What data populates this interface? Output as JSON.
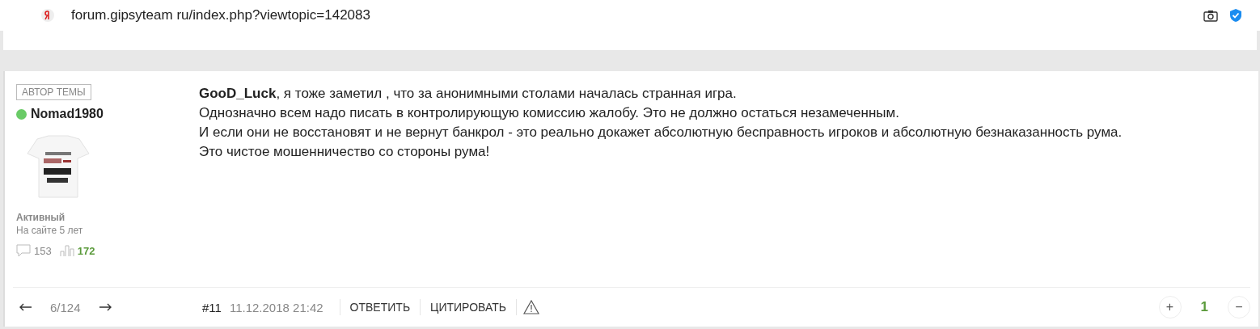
{
  "browser": {
    "url": "forum.gipsyteam ru/index.php?viewtopic=142083"
  },
  "post": {
    "author": {
      "badge": "АВТОР ТЕМЫ",
      "name": "Nomad1980",
      "online": true,
      "rank": "Активный",
      "since": "На сайте 5 лет",
      "posts": "153",
      "rating": "172"
    },
    "body": {
      "mention": "GooD_Luck",
      "lines": [
        ", я тоже заметил , что за анонимными столами началась странная игра.",
        "Однозначно всем надо писать в контролирующую комиссию жалобу. Это не должно остаться незамеченным.",
        "И если они не восстановят и не вернут банкрол - это реально докажет абсолютную бесправность игроков и абсолютную безнаказанность рума.",
        "Это чистое мошенничество со стороны рума!"
      ]
    },
    "footer": {
      "position": "6/124",
      "number": "#11",
      "date": "11.12.2018 21:42",
      "actions": [
        "ОТВЕТИТЬ",
        "ЦИТИРОВАТЬ"
      ],
      "plus": "+",
      "score": "1",
      "minus": "−"
    }
  }
}
